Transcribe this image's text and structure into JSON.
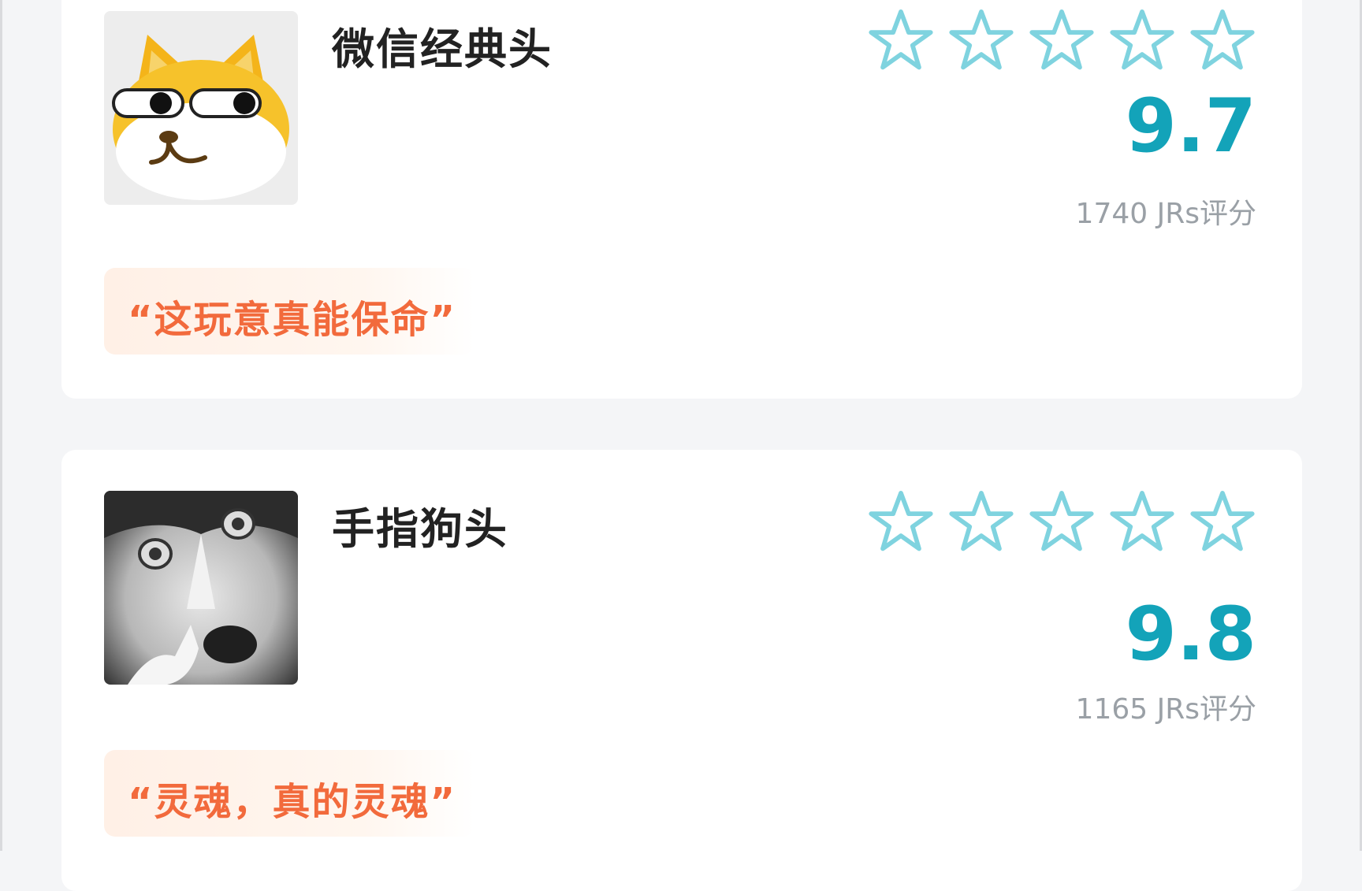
{
  "ratings": [
    {
      "name": "微信经典头",
      "score": "9.7",
      "count": "1740 JRs评分",
      "quote": "“这玩意真能保命”",
      "avatar_icon": "shiba-emoji-avatar"
    },
    {
      "name": "手指狗头",
      "score": "9.8",
      "count": "1165 JRs评分",
      "quote": "“灵魂，真的灵魂”",
      "avatar_icon": "husky-photo-avatar"
    }
  ],
  "colors": {
    "accent": "#13a3b9",
    "star_outline": "#7fd3df",
    "quote_text": "#f26a3c",
    "quote_bg": "#fff0e6",
    "count_text": "#9aa0a6"
  }
}
